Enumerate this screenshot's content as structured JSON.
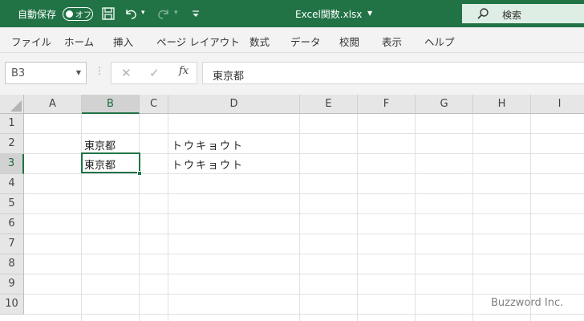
{
  "titlebar": {
    "autosave_label": "自動保存",
    "autosave_state": "オフ",
    "file_title": "Excel関数.xlsx",
    "search_placeholder": "検索"
  },
  "ribbon_tabs": [
    "ファイル",
    "ホーム",
    "挿入",
    "ページ レイアウト",
    "数式",
    "データ",
    "校閲",
    "表示",
    "ヘルプ"
  ],
  "formula_bar": {
    "name_box": "B3",
    "fx_label": "fx",
    "formula": "東京都"
  },
  "grid": {
    "columns": [
      "A",
      "B",
      "C",
      "D",
      "E",
      "F",
      "G",
      "H",
      "I"
    ],
    "rows": [
      "1",
      "2",
      "3",
      "4",
      "5",
      "6",
      "7",
      "8",
      "9",
      "10"
    ],
    "selected_column": "B",
    "selected_row": "3",
    "cells": {
      "B2": "東京都",
      "D2": "トウキョウト",
      "B3": "東京都",
      "D3": "トウキョウト"
    }
  },
  "watermark": "Buzzword Inc.",
  "colors": {
    "accent": "#217346"
  }
}
